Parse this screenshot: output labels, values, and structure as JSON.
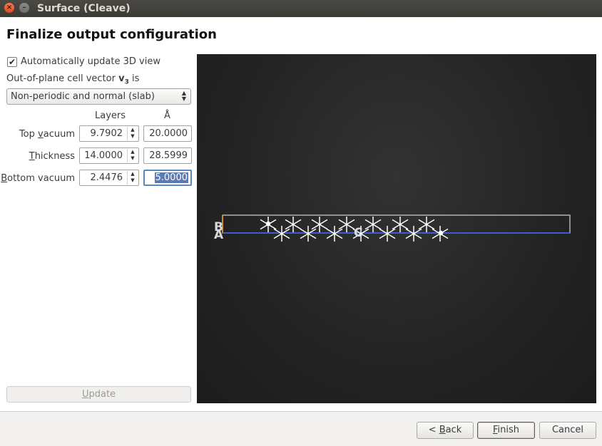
{
  "window": {
    "title": "Surface (Cleave)"
  },
  "page": {
    "heading": "Finalize output configuration"
  },
  "options": {
    "auto_update_label": "Automatically update 3D view",
    "auto_update_checked": true,
    "vector_label_prefix": "Out-of-plane cell vector ",
    "vector_label_symbol": "v",
    "vector_label_sub": "3",
    "vector_label_suffix": " is",
    "vector_mode": "Non-periodic and normal (slab)"
  },
  "table": {
    "col_layers": "Layers",
    "col_angstrom": "Å",
    "rows": [
      {
        "label_pre": "Top ",
        "label_ul": "v",
        "label_post": "acuum",
        "layers": "9.7902",
        "angstrom": "20.0000"
      },
      {
        "label_pre": "",
        "label_ul": "T",
        "label_post": "hickness",
        "layers": "14.0000",
        "angstrom": "28.5999"
      },
      {
        "label_pre": "",
        "label_ul": "B",
        "label_post": "ottom vacuum",
        "layers": "2.4476",
        "angstrom": "5.0000"
      }
    ]
  },
  "update_button": {
    "ul": "U",
    "rest": "pdate"
  },
  "viewer": {
    "axis_a": "A",
    "axis_b": "B",
    "axis_c": "C"
  },
  "footer": {
    "back_pre": "< ",
    "back_ul": "B",
    "back_rest": "ack",
    "finish_ul": "F",
    "finish_rest": "inish",
    "cancel": "Cancel"
  },
  "colors": {
    "axis_a": "#3d5bd6",
    "axis_b": "#d08a2a",
    "cell": "#c8c8c8",
    "atoms": "#ffffff"
  }
}
